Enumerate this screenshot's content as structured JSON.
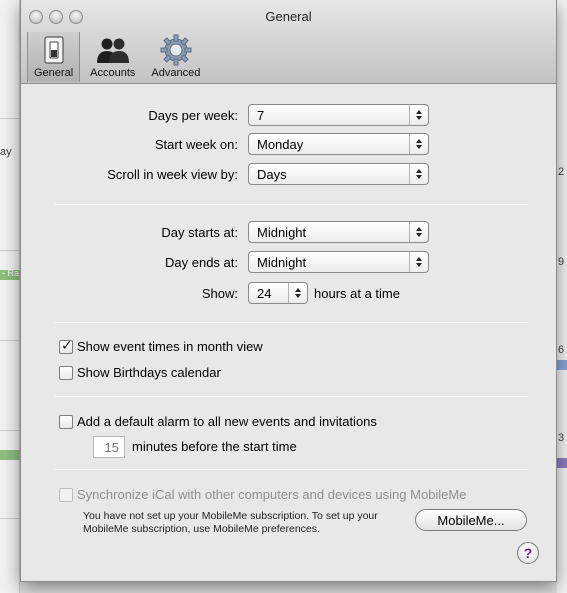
{
  "window": {
    "title": "General"
  },
  "tabs": [
    {
      "label": "General",
      "icon": "switch-icon",
      "active": true
    },
    {
      "label": "Accounts",
      "icon": "people-icon",
      "active": false
    },
    {
      "label": "Advanced",
      "icon": "gear-icon",
      "active": false
    }
  ],
  "calendar_section": {
    "days_per_week": {
      "label": "Days per week:",
      "value": "7"
    },
    "start_week_on": {
      "label": "Start week on:",
      "value": "Monday"
    },
    "scroll_week_view": {
      "label": "Scroll in week view by:",
      "value": "Days"
    }
  },
  "day_section": {
    "day_starts": {
      "label": "Day starts at:",
      "value": "Midnight"
    },
    "day_ends": {
      "label": "Day ends at:",
      "value": "Midnight"
    },
    "show": {
      "label": "Show:",
      "value": "24",
      "suffix": "hours at a time"
    }
  },
  "options": {
    "event_times": {
      "label": "Show event times in month view",
      "checked": true
    },
    "birthdays": {
      "label": "Show Birthdays calendar",
      "checked": false
    }
  },
  "alarm": {
    "label": "Add a default alarm to all new events and invitations",
    "checked": false,
    "minutes_value": "15",
    "minutes_label": "minutes before the start time"
  },
  "mobileme": {
    "label": "Synchronize iCal with other computers and devices using MobileMe",
    "enabled": false,
    "note_line1": "You have not set up your MobileMe subscription. To set up your",
    "note_line2": "MobileMe subscription, use MobileMe preferences.",
    "button_label": "MobileMe...",
    "help_label": "?"
  },
  "background_fragments": {
    "f1": "ay",
    "f2": "- Ra",
    "f3": "2",
    "f4": "9",
    "f5": "6",
    "f6": "3"
  }
}
